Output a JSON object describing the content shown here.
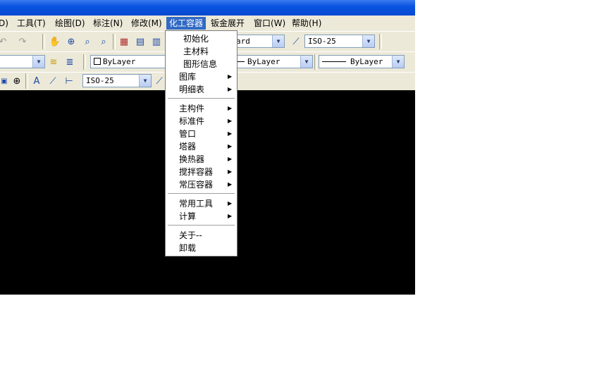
{
  "menubar": {
    "items": [
      {
        "label": "D)"
      },
      {
        "label": "工具(T)"
      },
      {
        "label": "绘图(D)"
      },
      {
        "label": "标注(N)"
      },
      {
        "label": "修改(M)"
      },
      {
        "label": "化工容器"
      },
      {
        "label": "钣金展开"
      },
      {
        "label": "窗口(W)"
      },
      {
        "label": "帮助(H)"
      }
    ]
  },
  "toolbar1": {
    "textstyle_value": "ard",
    "dimstyle_value": "ISO-25"
  },
  "toolbar2": {
    "color_value": "ByLayer",
    "linetype_value": "ByLayer",
    "lineweight_value": "ByLayer"
  },
  "toolbar3": {
    "dimstyle_value": "ISO-25"
  },
  "dropdown": {
    "items": [
      {
        "label": "初始化"
      },
      {
        "label": "主材料"
      },
      {
        "label": "图形信息"
      },
      {
        "label": "图库"
      },
      {
        "label": "明细表"
      },
      {
        "label": "主构件"
      },
      {
        "label": "标准件"
      },
      {
        "label": "管口"
      },
      {
        "label": "塔器"
      },
      {
        "label": "换热器"
      },
      {
        "label": "搅拌容器"
      },
      {
        "label": "常压容器"
      },
      {
        "label": "常用工具"
      },
      {
        "label": "计算"
      },
      {
        "label": "关于--"
      },
      {
        "label": "卸载"
      }
    ]
  },
  "icons": {
    "submenu_arrow": "triangle-right-icon",
    "combo_arrow": "chevron-down-icon"
  },
  "colors": {
    "titlebar": "#0a55e0",
    "menu_highlight": "#316ac5",
    "toolbar_bg": "#ece9d8",
    "canvas_bg": "#000000"
  }
}
